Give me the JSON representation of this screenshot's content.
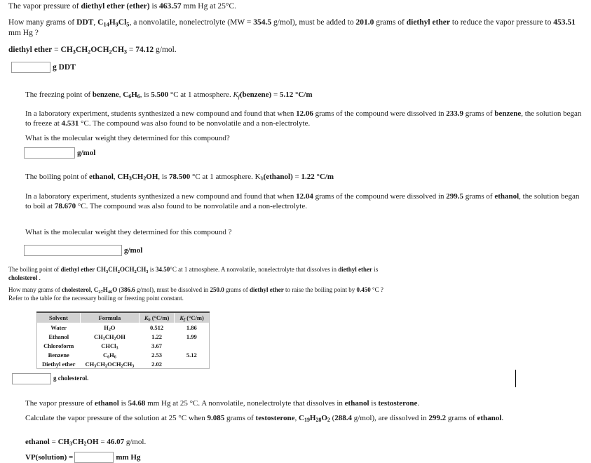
{
  "section_vp_ddt": {
    "statement_prefix": "The vapor pressure of ",
    "solvent_name": "diethyl ether (ether)",
    "statement_mid": " is ",
    "vapor_pressure": "463.57",
    "vapor_pressure_unit": " mm Hg at 25°C.",
    "question_a": "How many grams of ",
    "solute_name": "DDT",
    "solute_formula_parts": [
      "C",
      "14",
      "H",
      "9",
      "Cl",
      "5"
    ],
    "question_b": ", a nonvolatile, nonelectrolyte (MW = ",
    "solute_mw": "354.5",
    "question_c": " g/mol), must be added to ",
    "solvent_mass": "201.0",
    "question_d": " grams of ",
    "solvent_name_2": "diethyl ether",
    "question_e": " to reduce the vapor pressure to ",
    "final_vp": "453.51",
    "question_f": " mm Hg ?",
    "solvent_label": "diethyl ether",
    "solvent_eq": " = ",
    "solvent_formula": "CH3CH2OCH2CH3",
    "solvent_mm_eq": " = ",
    "solvent_mm": "74.12",
    "solvent_mm_unit": " g/mol.",
    "answer_value": "",
    "answer_unit": "g DDT"
  },
  "section_fp_benzene": {
    "statement_a": "The freezing point of ",
    "solvent_name": "benzene",
    "statement_b": ", ",
    "solvent_formula_parts": [
      "C",
      "6",
      "H",
      "6"
    ],
    "statement_c": ", is ",
    "freezing_point": "5.500",
    "statement_d": " °C at 1 atmosphere. ",
    "constant_symbol": "K",
    "constant_subscript": "f",
    "constant_arg": "(benzene)",
    "constant_eq": " = ",
    "constant_value": "5.12",
    "constant_unit": " °C/m",
    "body_a": "In a laboratory experiment, students synthesized a new compound and found that when ",
    "solute_mass": "12.06",
    "body_b": " grams of the compound were dissolved in ",
    "solvent_mass": "233.9",
    "body_c": " grams of ",
    "solvent_name_2": "benzene",
    "body_d": ", the solution began to freeze at ",
    "solution_fp": "4.531",
    "body_e": " °C. The compound was also found to be nonvolatile and a non-electrolyte.",
    "question": "What is the molecular weight they determined for this compound?",
    "answer_value": "",
    "answer_unit": "g/mol"
  },
  "section_bp_ethanol": {
    "statement_a": "The boiling point of ",
    "solvent_name": "ethanol",
    "statement_b": ", ",
    "solvent_formula": "CH3CH2OH",
    "statement_c": ", is ",
    "boiling_point": "78.500",
    "statement_d": " °C at 1 atmosphere. ",
    "constant_symbol": "K",
    "constant_subscript": "b",
    "constant_arg": "(ethanol)",
    "constant_eq": " = ",
    "constant_value": "1.22",
    "constant_unit": " °C/m",
    "body_a": "In a laboratory experiment, students synthesized a new compound and found that when ",
    "solute_mass": "12.04",
    "body_b": " grams of the compound were dissolved in ",
    "solvent_mass": "299.5",
    "body_c": " grams of ",
    "solvent_name_2": "ethanol",
    "body_d": ", the solution began to boil at ",
    "solution_bp": "78.670",
    "body_e": " °C. The compound was also found to be nonvolatile and a non-electrolyte.",
    "question": "What is the molecular weight they determined for this compound ?",
    "answer_value": "",
    "answer_unit": "g/mol"
  },
  "section_bp_cholesterol": {
    "statement_a": "The boiling point of ",
    "solvent_name": "diethyl ether",
    "statement_space": " ",
    "solvent_formula": "CH3CH2OCH2CH3",
    "statement_b": " is ",
    "boiling_point": "34.50",
    "statement_c": "°C at 1 atmosphere. A nonvolatile, nonelectrolyte that dissolves in ",
    "solvent_name_2": "diethyl ether",
    "statement_d": " is",
    "solute_name": "cholesterol",
    "statement_e": " .",
    "question_a": "How many grams of ",
    "solute_name_2": "cholesterol",
    "question_b": ", ",
    "solute_formula_parts": [
      "C",
      "27",
      "H",
      "46",
      "O"
    ],
    "question_c": " (",
    "solute_mw": "386.6",
    "question_d": " g/mol), must be dissolved in ",
    "solvent_mass": "250.0",
    "question_e": " grams of ",
    "solvent_name_3": "diethyl ether",
    "question_f": " to raise the boiling point by ",
    "delta_t": "0.450",
    "question_g": " °C ?",
    "refer_note": "Refer to the table for the necessary boiling or freezing point constant.",
    "answer_value": "",
    "answer_unit": "g cholesterol."
  },
  "constants_table": {
    "headers": [
      "Solvent",
      "Formula",
      "Kb (°C/m)",
      "Kf (°C/m)"
    ],
    "header_kb_symbol": "K",
    "header_kb_sub": "b",
    "header_kb_unit": " (°C/m)",
    "header_kf_symbol": "K",
    "header_kf_sub": "f",
    "header_kf_unit": " (°C/m)",
    "rows": [
      {
        "solvent": "Water",
        "formula_parts": [
          "H",
          "2",
          "O"
        ],
        "kb": "0.512",
        "kf": "1.86"
      },
      {
        "solvent": "Ethanol",
        "formula_parts": [
          "CH",
          "3",
          "CH",
          "2",
          "OH"
        ],
        "kb": "1.22",
        "kf": "1.99"
      },
      {
        "solvent": "Chloroform",
        "formula_parts": [
          "CHCl",
          "3"
        ],
        "kb": "3.67",
        "kf": ""
      },
      {
        "solvent": "Benzene",
        "formula_parts": [
          "C",
          "6",
          "H",
          "6"
        ],
        "kb": "2.53",
        "kf": "5.12"
      },
      {
        "solvent": "Diethyl ether",
        "formula_parts": [
          "CH",
          "3",
          "CH",
          "2",
          "OCH",
          "2",
          "CH",
          "3"
        ],
        "kb": "2.02",
        "kf": ""
      }
    ]
  },
  "section_vp_testosterone": {
    "statement_a": "The vapor pressure of ",
    "solvent_name": "ethanol",
    "statement_b": " is ",
    "vapor_pressure": "54.68",
    "statement_c": " mm Hg at 25 °C. A nonvolatile, nonelectrolyte that dissolves in ",
    "solvent_name_2": "ethanol",
    "statement_d": " is ",
    "solute_name": "testosterone",
    "statement_e": ".",
    "question_a": "Calculate the vapor pressure of the solution at 25 °C when ",
    "solute_mass": "9.085",
    "question_b": " grams of ",
    "solute_name_2": "testosterone",
    "question_c": ", ",
    "solute_formula_parts": [
      "C",
      "19",
      "H",
      "28",
      "O",
      "2"
    ],
    "question_d": " (",
    "solute_mw": "288.4",
    "question_e": " g/mol), are dissolved in ",
    "solvent_mass": "299.2",
    "question_f": " grams of ",
    "solvent_name_3": "ethanol",
    "question_g": ".",
    "solvent_label": "ethanol",
    "solvent_eq": " = ",
    "solvent_formula": "CH3CH2OH",
    "solvent_mm_eq": " = ",
    "solvent_mm": "46.07",
    "solvent_mm_unit": " g/mol.",
    "answer_prefix": "VP(solution) =",
    "answer_value": "",
    "answer_unit": "mm Hg"
  }
}
